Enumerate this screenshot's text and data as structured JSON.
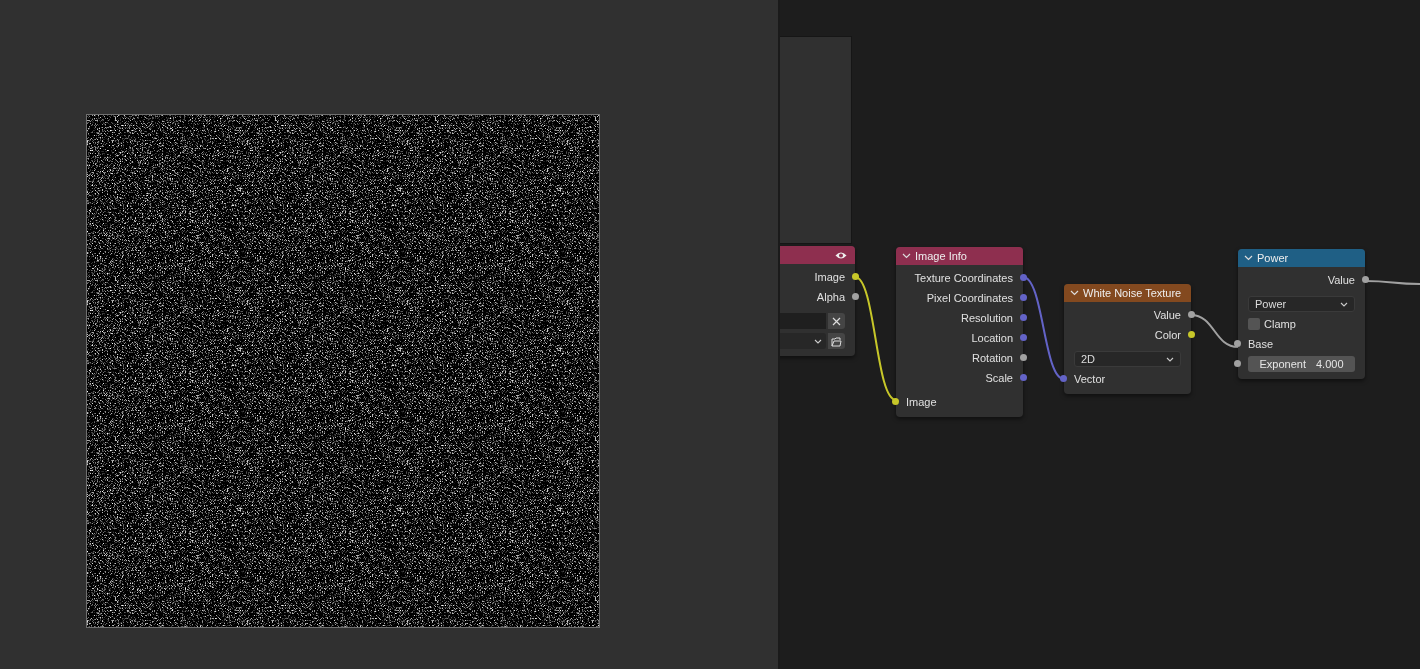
{
  "node_editor": {
    "nodes": [
      {
        "color": "#8e2f4f",
        "rows": [
          {
            "kind": "output",
            "label": "Image",
            "color": "#c7c729"
          },
          {
            "kind": "output",
            "label": "Alpha",
            "color": "#a1a1a1"
          },
          {
            "kind": "text_field"
          },
          {
            "kind": "file_select"
          }
        ]
      },
      {
        "title": "Image Info",
        "color": "#8e2f4f",
        "rows": [
          {
            "kind": "output",
            "label": "Texture Coordinates",
            "color": "#6363c7"
          },
          {
            "kind": "output",
            "label": "Pixel Coordinates",
            "color": "#6363c7"
          },
          {
            "kind": "output",
            "label": "Resolution",
            "color": "#6363c7"
          },
          {
            "kind": "output",
            "label": "Location",
            "color": "#6363c7"
          },
          {
            "kind": "output",
            "label": "Rotation",
            "color": "#a1a1a1"
          },
          {
            "kind": "output",
            "label": "Scale",
            "color": "#6363c7"
          },
          {
            "kind": "input",
            "label": "Image",
            "color": "#c7c729"
          }
        ]
      },
      {
        "title": "White Noise Texture",
        "color": "#83491f",
        "rows": [
          {
            "kind": "output",
            "label": "Value",
            "color": "#a1a1a1"
          },
          {
            "kind": "output",
            "label": "Color",
            "color": "#c7c729"
          },
          {
            "kind": "dropdown",
            "value": "2D"
          },
          {
            "kind": "input",
            "label": "Vector",
            "color": "#6363c7"
          }
        ]
      },
      {
        "title": "Power",
        "color": "#1f5f85",
        "rows": [
          {
            "kind": "output",
            "label": "Value",
            "color": "#a1a1a1"
          },
          {
            "kind": "dropdown",
            "value": "Power"
          },
          {
            "kind": "checkbox",
            "label": "Clamp",
            "checked": false
          },
          {
            "kind": "input",
            "label": "Base",
            "color": "#a1a1a1"
          },
          {
            "kind": "number_input",
            "label": "Exponent",
            "value": "4.000",
            "color": "#a1a1a1"
          }
        ]
      }
    ]
  }
}
